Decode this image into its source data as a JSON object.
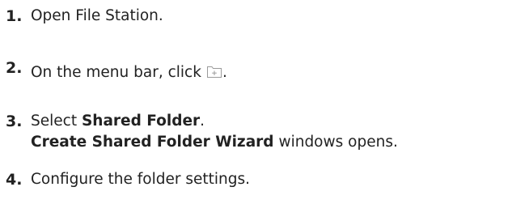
{
  "steps": [
    {
      "number": "1.",
      "text": "Open File Station."
    },
    {
      "number": "2.",
      "text_before": "On the menu bar, click",
      "icon": "new-folder-icon",
      "text_after": "."
    },
    {
      "number": "3.",
      "text_before": "Select ",
      "bold_1": "Shared Folder",
      "text_after": ".",
      "line2_bold": "Create Shared Folder Wizard",
      "line2_rest": " windows opens."
    },
    {
      "number": "4.",
      "text": "Configure the folder settings."
    }
  ],
  "colors": {
    "text": "#222222",
    "icon_stroke": "#9a9a9a"
  }
}
